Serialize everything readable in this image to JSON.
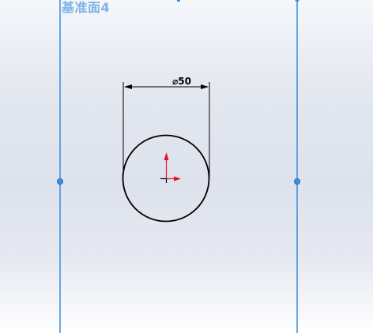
{
  "plane": {
    "label": "基准面4",
    "color": "#2f86d6",
    "label_color": "#7fb2e8"
  },
  "sketch": {
    "dimension_text": "⌀50",
    "dimension_symbol": "diameter-symbol",
    "circle_color": "#000000",
    "origin_color": "#e0141e"
  }
}
